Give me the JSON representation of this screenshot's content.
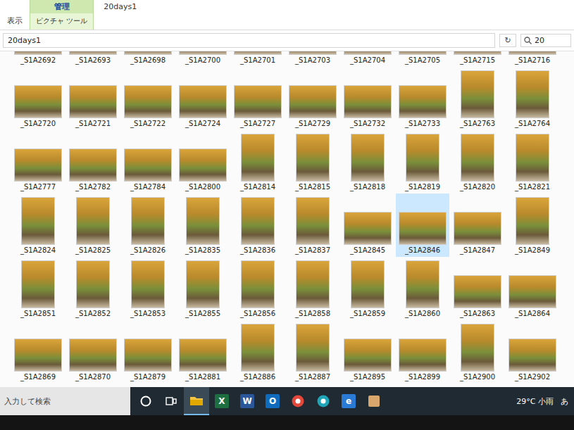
{
  "window": {
    "title": "20days1"
  },
  "ribbon": {
    "tabs": [
      {
        "label": "表示",
        "selected": false
      },
      {
        "label": "管理",
        "selected": true
      }
    ],
    "context_label": "ピクチャ ツール"
  },
  "address": {
    "path": "20days1",
    "refresh": "↻"
  },
  "search": {
    "text": "20"
  },
  "files": [
    {
      "name": "_S1A2692",
      "kind": "landscape",
      "selected": false
    },
    {
      "name": "_S1A2693",
      "kind": "landscape",
      "selected": false
    },
    {
      "name": "_S1A2698",
      "kind": "landscape",
      "selected": false
    },
    {
      "name": "_S1A2700",
      "kind": "landscape",
      "selected": false
    },
    {
      "name": "_S1A2701",
      "kind": "landscape",
      "selected": false
    },
    {
      "name": "_S1A2703",
      "kind": "landscape",
      "selected": false
    },
    {
      "name": "_S1A2704",
      "kind": "landscape",
      "selected": false
    },
    {
      "name": "_S1A2705",
      "kind": "landscape",
      "selected": false
    },
    {
      "name": "_S1A2715",
      "kind": "landscape",
      "selected": false
    },
    {
      "name": "_S1A2716",
      "kind": "landscape",
      "selected": false
    },
    {
      "name": "_S1A2720",
      "kind": "landscape",
      "selected": false
    },
    {
      "name": "_S1A2721",
      "kind": "landscape",
      "selected": false
    },
    {
      "name": "_S1A2722",
      "kind": "landscape",
      "selected": false
    },
    {
      "name": "_S1A2724",
      "kind": "landscape",
      "selected": false
    },
    {
      "name": "_S1A2727",
      "kind": "landscape",
      "selected": false
    },
    {
      "name": "_S1A2729",
      "kind": "landscape",
      "selected": false
    },
    {
      "name": "_S1A2732",
      "kind": "landscape",
      "selected": false
    },
    {
      "name": "_S1A2733",
      "kind": "landscape",
      "selected": false
    },
    {
      "name": "_S1A2763",
      "kind": "portrait",
      "selected": false
    },
    {
      "name": "_S1A2764",
      "kind": "portrait",
      "selected": false
    },
    {
      "name": "_S1A2777",
      "kind": "landscape",
      "selected": false
    },
    {
      "name": "_S1A2782",
      "kind": "landscape",
      "selected": false
    },
    {
      "name": "_S1A2784",
      "kind": "landscape",
      "selected": false
    },
    {
      "name": "_S1A2800",
      "kind": "landscape",
      "selected": false
    },
    {
      "name": "_S1A2814",
      "kind": "portrait",
      "selected": false
    },
    {
      "name": "_S1A2815",
      "kind": "portrait",
      "selected": false
    },
    {
      "name": "_S1A2818",
      "kind": "portrait",
      "selected": false
    },
    {
      "name": "_S1A2819",
      "kind": "portrait",
      "selected": false
    },
    {
      "name": "_S1A2820",
      "kind": "portrait",
      "selected": false
    },
    {
      "name": "_S1A2821",
      "kind": "portrait",
      "selected": false
    },
    {
      "name": "_S1A2824",
      "kind": "portrait",
      "selected": false
    },
    {
      "name": "_S1A2825",
      "kind": "portrait",
      "selected": false
    },
    {
      "name": "_S1A2826",
      "kind": "portrait",
      "selected": false
    },
    {
      "name": "_S1A2835",
      "kind": "portrait",
      "selected": false
    },
    {
      "name": "_S1A2836",
      "kind": "portrait",
      "selected": false
    },
    {
      "name": "_S1A2837",
      "kind": "portrait",
      "selected": false
    },
    {
      "name": "_S1A2845",
      "kind": "landscape",
      "selected": false
    },
    {
      "name": "_S1A2846",
      "kind": "landscape",
      "selected": true
    },
    {
      "name": "_S1A2847",
      "kind": "landscape",
      "selected": false
    },
    {
      "name": "_S1A2849",
      "kind": "portrait",
      "selected": false
    },
    {
      "name": "_S1A2851",
      "kind": "portrait",
      "selected": false
    },
    {
      "name": "_S1A2852",
      "kind": "portrait",
      "selected": false
    },
    {
      "name": "_S1A2853",
      "kind": "portrait",
      "selected": false
    },
    {
      "name": "_S1A2855",
      "kind": "portrait",
      "selected": false
    },
    {
      "name": "_S1A2856",
      "kind": "portrait",
      "selected": false
    },
    {
      "name": "_S1A2858",
      "kind": "portrait",
      "selected": false
    },
    {
      "name": "_S1A2859",
      "kind": "portrait",
      "selected": false
    },
    {
      "name": "_S1A2860",
      "kind": "portrait",
      "selected": false
    },
    {
      "name": "_S1A2863",
      "kind": "landscape",
      "selected": false
    },
    {
      "name": "_S1A2864",
      "kind": "landscape",
      "selected": false
    },
    {
      "name": "_S1A2869",
      "kind": "landscape",
      "selected": false
    },
    {
      "name": "_S1A2870",
      "kind": "landscape",
      "selected": false
    },
    {
      "name": "_S1A2879",
      "kind": "landscape",
      "selected": false
    },
    {
      "name": "_S1A2881",
      "kind": "landscape",
      "selected": false
    },
    {
      "name": "_S1A2886",
      "kind": "portrait",
      "selected": false
    },
    {
      "name": "_S1A2887",
      "kind": "portrait",
      "selected": false
    },
    {
      "name": "_S1A2895",
      "kind": "landscape",
      "selected": false
    },
    {
      "name": "_S1A2899",
      "kind": "landscape",
      "selected": false
    },
    {
      "name": "_S1A2900",
      "kind": "portrait",
      "selected": false
    },
    {
      "name": "_S1A2902",
      "kind": "landscape",
      "selected": false
    }
  ],
  "taskbar": {
    "search_placeholder": "入力して検索",
    "apps": [
      {
        "kind": "ring",
        "color": "#ffffff",
        "active": false
      },
      {
        "kind": "taskview",
        "color": "#ffffff",
        "active": false
      },
      {
        "kind": "folder",
        "color": "#f4c542",
        "active": true
      },
      {
        "kind": "letter",
        "glyph": "X",
        "color": "#1d6f42",
        "active": false
      },
      {
        "kind": "letter",
        "glyph": "W",
        "color": "#2b579a",
        "active": false
      },
      {
        "kind": "letter",
        "glyph": "O",
        "color": "#0f6cbd",
        "active": false
      },
      {
        "kind": "logo",
        "color": "#e4483b",
        "active": false
      },
      {
        "kind": "logo",
        "color": "#1fa5b8",
        "active": false
      },
      {
        "kind": "letter",
        "glyph": "e",
        "color": "#2a7bd6",
        "active": false
      },
      {
        "kind": "square",
        "color": "#d9a66b",
        "active": false
      }
    ],
    "weather": "29°C 小雨",
    "ime": "あ"
  }
}
